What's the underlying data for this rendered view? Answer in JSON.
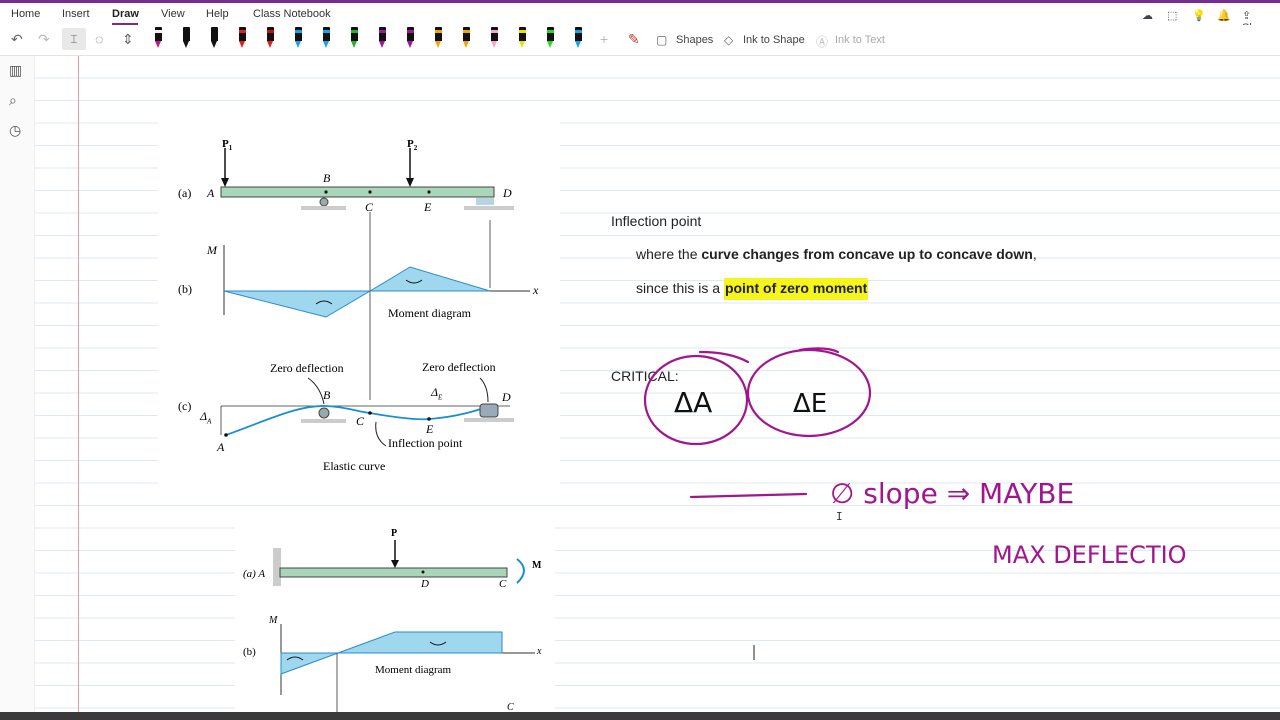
{
  "menubar": {
    "tabs": [
      {
        "label": "Home"
      },
      {
        "label": "Insert"
      },
      {
        "label": "Draw"
      },
      {
        "label": "View"
      },
      {
        "label": "Help"
      },
      {
        "label": "Class Notebook"
      }
    ],
    "active_tab": "Draw",
    "share_label": "Share"
  },
  "toolbar": {
    "shapes_label": "Shapes",
    "ink_to_shape_label": "Ink to Shape",
    "ink_to_text_label": "Ink to Text",
    "pens": [
      {
        "color": "#c01890",
        "band": "#f2f2f2"
      },
      {
        "color": "#111111",
        "band": "#111111"
      },
      {
        "color": "#111111",
        "band": "#111111"
      },
      {
        "color": "#e02020",
        "band": "#e02020"
      },
      {
        "color": "#e02020",
        "band": "#c01010"
      },
      {
        "color": "#1aa3e8",
        "band": "#1aa3e8"
      },
      {
        "color": "#1aa3e8",
        "band": "#1aa3e8"
      },
      {
        "color": "#27b327",
        "band": "#27b327"
      },
      {
        "color": "#a0169b",
        "band": "#a0169b"
      },
      {
        "color": "#a0169b",
        "band": "#a0169b"
      },
      {
        "color": "#f0a800",
        "band": "#f0a800"
      },
      {
        "color": "#f0a800",
        "band": "#f0a800"
      },
      {
        "color": "#f4a6d0",
        "band": "#f4a6d0"
      },
      {
        "color": "#f0e000",
        "band": "#f0e000"
      },
      {
        "color": "#27d827",
        "band": "#27d827"
      },
      {
        "color": "#1aa3e8",
        "band": "#1aa3e8"
      }
    ]
  },
  "figure1": {
    "p1": "P",
    "p1_sub": "1",
    "p2": "P",
    "p2_sub": "2",
    "label_a": "(a)",
    "label_b": "(b)",
    "label_c": "(c)",
    "pt_A": "A",
    "pt_B": "B",
    "pt_C": "C",
    "pt_D": "D",
    "pt_E": "E",
    "axis_M": "M",
    "axis_x": "x",
    "moment_diagram": "Moment diagram",
    "zero_deflection_left": "Zero deflection",
    "zero_deflection_right": "Zero deflection",
    "delta_E": "Δ",
    "delta_E_sub": "E",
    "delta_A": "Δ",
    "delta_A_sub": "A",
    "inflection_point": "Inflection point",
    "elastic_curve": "Elastic curve"
  },
  "figure2": {
    "p": "P",
    "m": "M",
    "label_a": "(a) A",
    "label_b": "(b)",
    "pt_D": "D",
    "pt_C": "C",
    "pt_C2": "C",
    "axis_M": "M",
    "axis_x": "x",
    "moment_diagram": "Moment diagram"
  },
  "notes": {
    "heading": "Inflection point",
    "line1_prefix": "where the ",
    "line1_bold": "curve changes from concave up to concave down",
    "line1_suffix": ",",
    "line2_prefix": "since this is a ",
    "line2_highlight": "point of zero moment",
    "critical": "CRITICAL:"
  },
  "ink": {
    "delta_a": "ΔA",
    "delta_e": "ΔE",
    "zero_slope": "∅ slope ⇒ MAYBE",
    "max_deflection": "MAX DEFLECTIO",
    "ink_color": "#a0168f"
  }
}
